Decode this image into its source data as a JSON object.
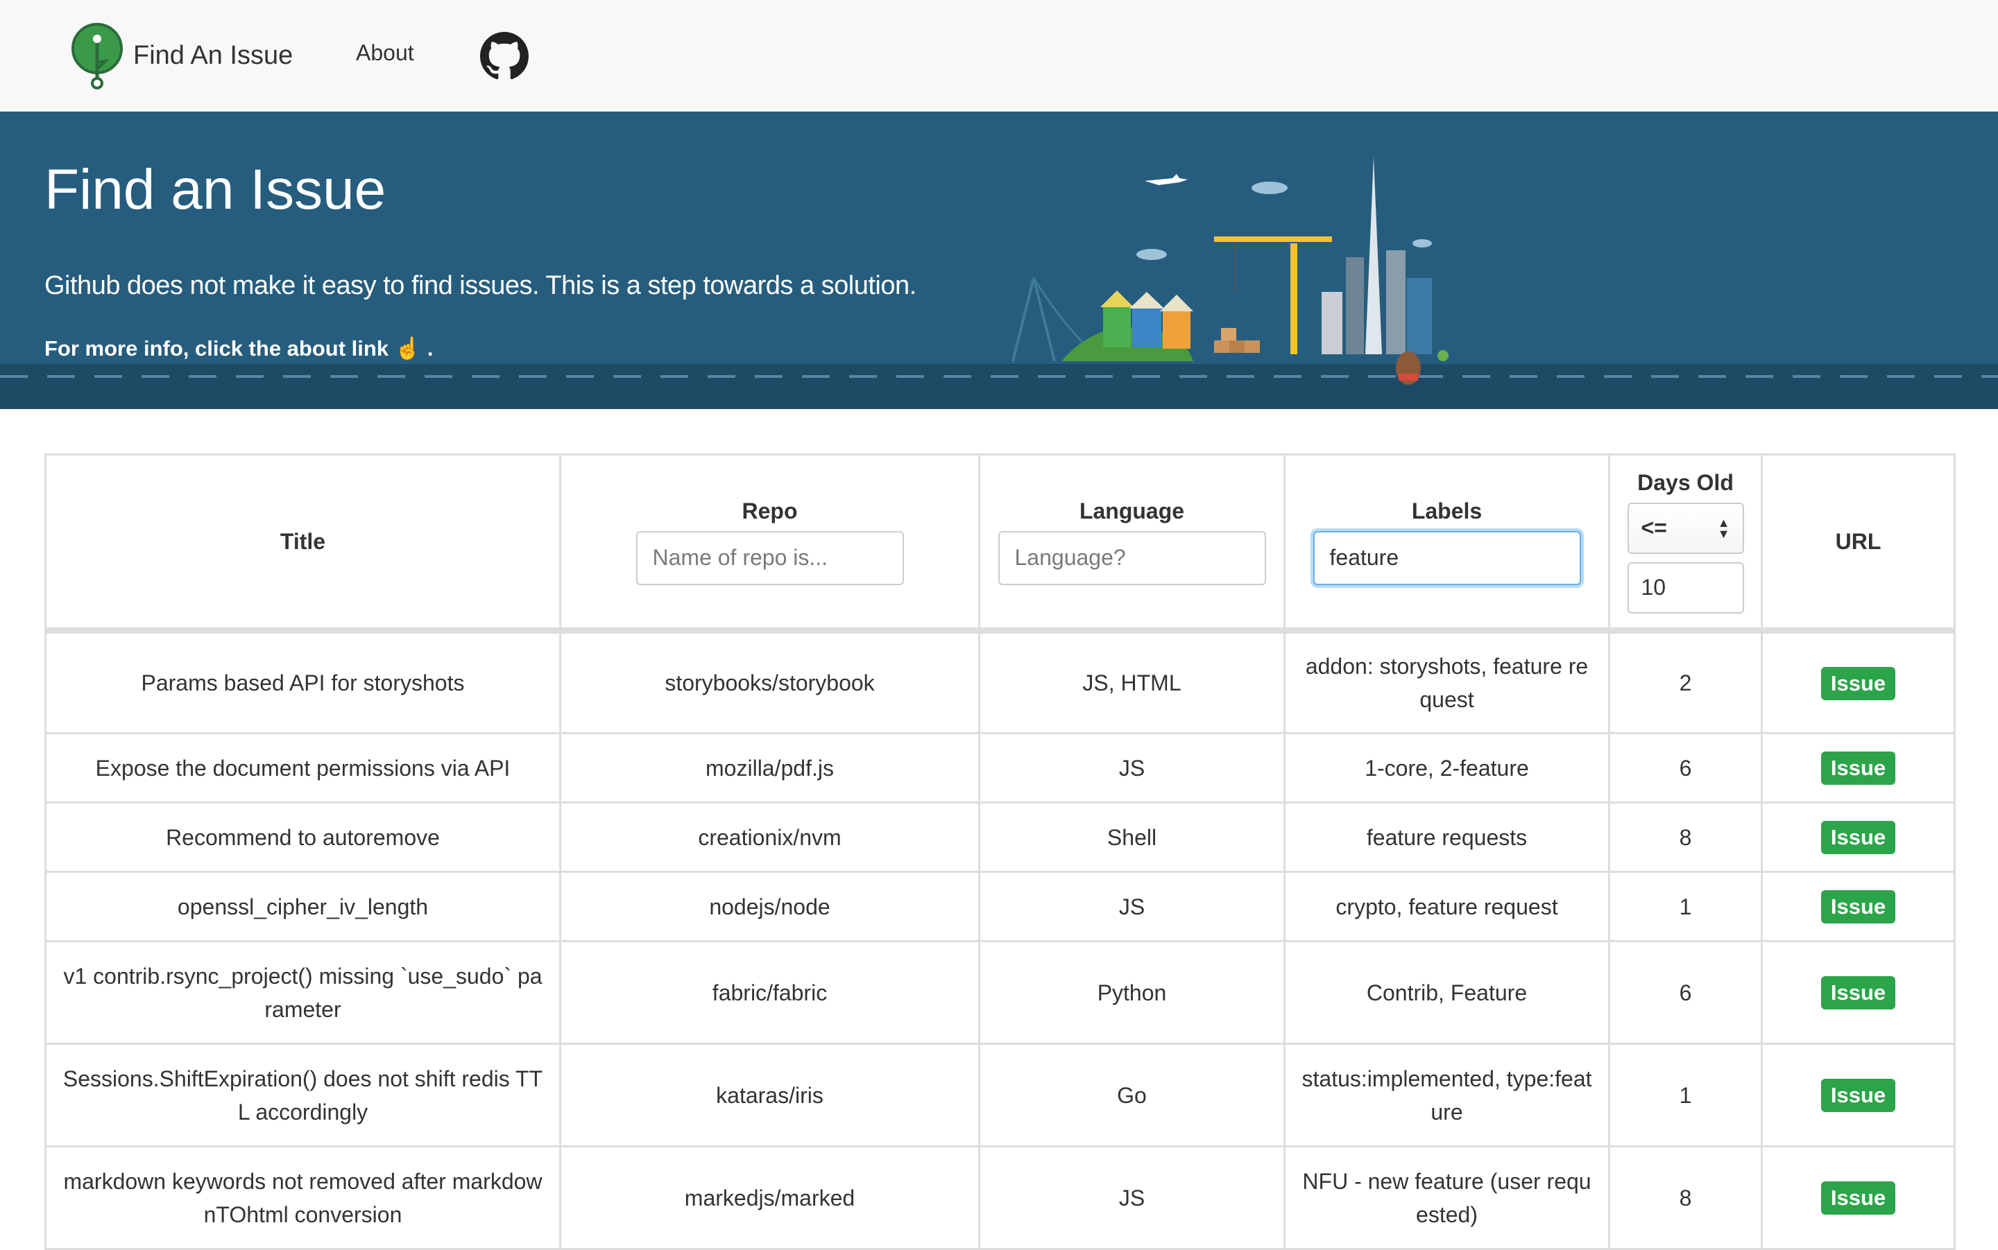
{
  "nav": {
    "brand": "Find An Issue",
    "about": "About",
    "github_icon": "github-icon"
  },
  "hero": {
    "title": "Find an Issue",
    "subtitle": "Github does not make it easy to find issues. This is a step towards a solution.",
    "info": "For more info, click the about link ☝ ."
  },
  "table": {
    "headers": {
      "title": "Title",
      "repo": "Repo",
      "language": "Language",
      "labels": "Labels",
      "days_old": "Days Old",
      "url": "URL"
    },
    "filters": {
      "repo_placeholder": "Name of repo is...",
      "language_placeholder": "Language?",
      "labels_value": "feature",
      "days_operator": "<=",
      "days_value": "10"
    },
    "rows": [
      {
        "title": "Params based API for storyshots",
        "repo": "storybooks/storybook",
        "language": "JS, HTML",
        "labels": "addon: storyshots, feature request",
        "days": "2",
        "url": "Issue"
      },
      {
        "title": "Expose the document permissions via API",
        "repo": "mozilla/pdf.js",
        "language": "JS",
        "labels": "1-core, 2-feature",
        "days": "6",
        "url": "Issue"
      },
      {
        "title": "Recommend to autoremove",
        "repo": "creationix/nvm",
        "language": "Shell",
        "labels": "feature requests",
        "days": "8",
        "url": "Issue"
      },
      {
        "title": "openssl_cipher_iv_length",
        "repo": "nodejs/node",
        "language": "JS",
        "labels": "crypto, feature request",
        "days": "1",
        "url": "Issue"
      },
      {
        "title": "v1 contrib.rsync_project() missing `use_sudo` parameter",
        "repo": "fabric/fabric",
        "language": "Python",
        "labels": "Contrib, Feature",
        "days": "6",
        "url": "Issue"
      },
      {
        "title": "Sessions.ShiftExpiration() does not shift redis TTL accordingly",
        "repo": "kataras/iris",
        "language": "Go",
        "labels": "status:implemented, type:feature",
        "days": "1",
        "url": "Issue"
      },
      {
        "title": "markdown keywords not removed after markdownTOhtml conversion",
        "repo": "markedjs/marked",
        "language": "JS",
        "labels": "NFU - new feature (user requested)",
        "days": "8",
        "url": "Issue"
      }
    ]
  },
  "colors": {
    "hero_bg": "#265d7e",
    "issue_button": "#2ca44a",
    "navbar_bg": "#f8f8f8"
  }
}
